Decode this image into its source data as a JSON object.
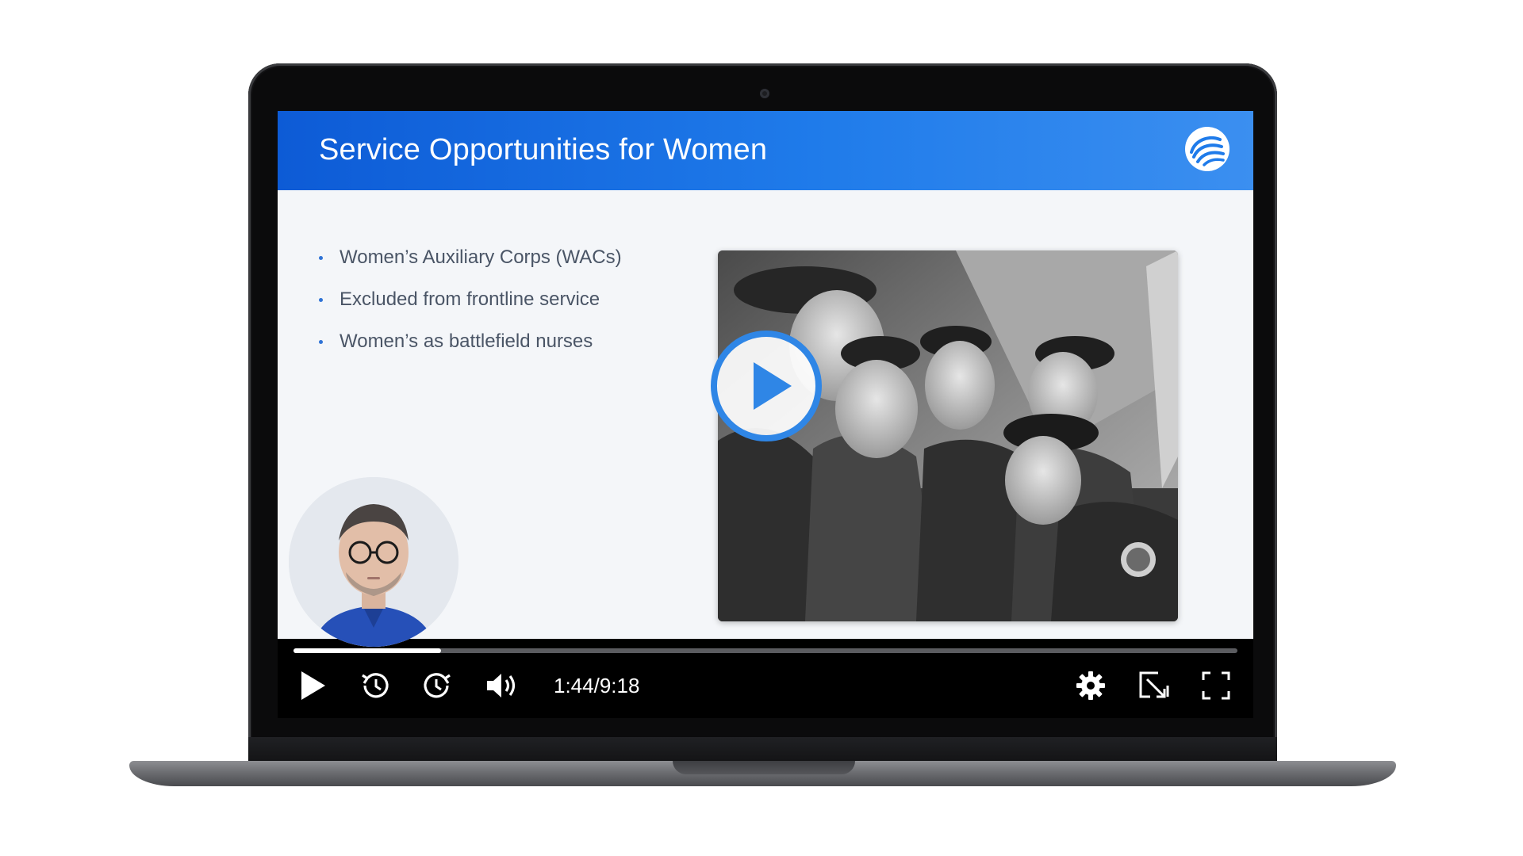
{
  "slide": {
    "title": "Service Opportunities for Women",
    "bullets": [
      "Women’s Auxiliary Corps (WACs)",
      "Excluded from frontline service",
      "Women’s as battlefield nurses"
    ],
    "photo": "black-and-white photo of women soldiers in uniform",
    "presenter": "presenter-avatar",
    "logo_icon": "spiral-logo-icon"
  },
  "player": {
    "time": "1:44/9:18",
    "progress_fraction": 0.156,
    "icons": {
      "play": "play-icon",
      "rewind": "rewind-icon",
      "forward": "forward-icon",
      "volume": "volume-icon",
      "settings": "gear-icon",
      "pip": "picture-in-picture-icon",
      "fullscreen": "fullscreen-icon",
      "overlay_play": "play-overlay-icon"
    }
  },
  "colors": {
    "header_blue": "#1a6fe3",
    "accent_blue": "#2f73d6",
    "controls_bg": "#000000",
    "text_gray": "#4a5566"
  }
}
